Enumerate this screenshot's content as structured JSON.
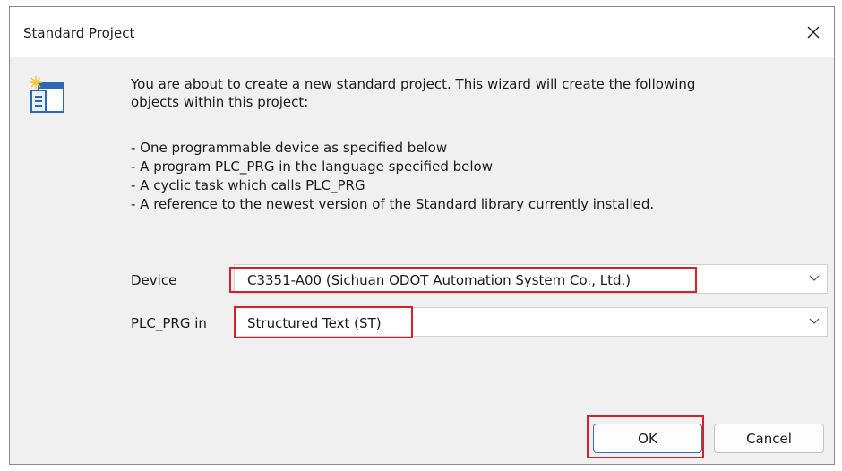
{
  "dialog": {
    "title": "Standard Project",
    "icons": {
      "close": "close-icon",
      "project": "project-wizard-icon"
    }
  },
  "intro": {
    "line1": "You are about to create a new standard project. This wizard will create the following",
    "line2": "objects within this project:"
  },
  "bullets": [
    "- One programmable device as specified below",
    "- A program PLC_PRG in the language specified below",
    "- A cyclic task which calls PLC_PRG",
    "- A reference to the newest version of the Standard library currently installed."
  ],
  "device": {
    "label": "Device",
    "value": "C3351-A00 (Sichuan ODOT Automation System Co., Ltd.)"
  },
  "plc_prg": {
    "label": "PLC_PRG in",
    "value": "Structured Text (ST)"
  },
  "buttons": {
    "ok": "OK",
    "cancel": "Cancel"
  },
  "colors": {
    "highlight": "#d6202a",
    "dialog_bg": "#f0f0f0",
    "ok_border": "#3b6fb6"
  }
}
